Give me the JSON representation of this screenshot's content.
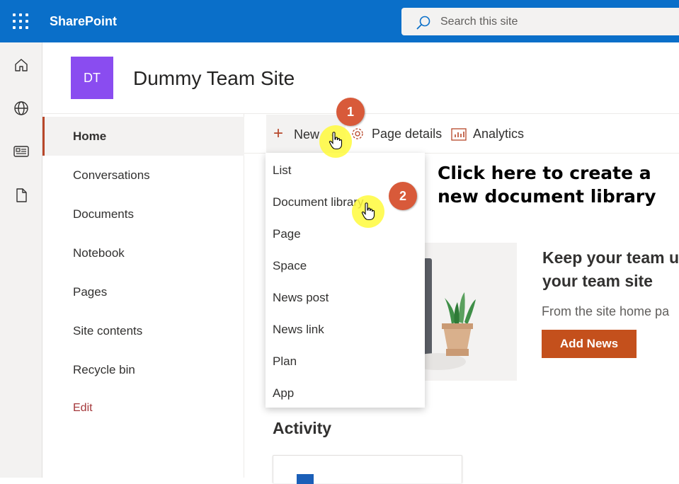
{
  "topbar": {
    "app_name": "SharePoint",
    "search_placeholder": "Search this site"
  },
  "rail": {
    "icons": [
      "home-icon",
      "globe-icon",
      "news-icon",
      "file-icon"
    ]
  },
  "site": {
    "logo_initials": "DT",
    "title": "Dummy Team Site"
  },
  "leftnav": {
    "items": [
      "Home",
      "Conversations",
      "Documents",
      "Notebook",
      "Pages",
      "Site contents",
      "Recycle bin"
    ],
    "edit_label": "Edit"
  },
  "commandbar": {
    "new_label": "New",
    "page_details_label": "Page details",
    "analytics_label": "Analytics"
  },
  "new_menu": {
    "items": [
      "List",
      "Document library",
      "Page",
      "Space",
      "News post",
      "News link",
      "Plan",
      "App"
    ]
  },
  "annotations": {
    "step1": "1",
    "step2": "2",
    "callout": "Click here to create a new document library"
  },
  "news": {
    "heading_line1": "Keep your team u",
    "heading_line2": "your team site",
    "subtext": "From the site home pa",
    "add_button": "Add News"
  },
  "activity": {
    "heading": "Activity"
  },
  "colors": {
    "topbar": "#0a6fc9",
    "accent": "#b7472a",
    "badge": "#d85a3a",
    "logo": "#8a4cf0",
    "add_news": "#c4501c"
  }
}
